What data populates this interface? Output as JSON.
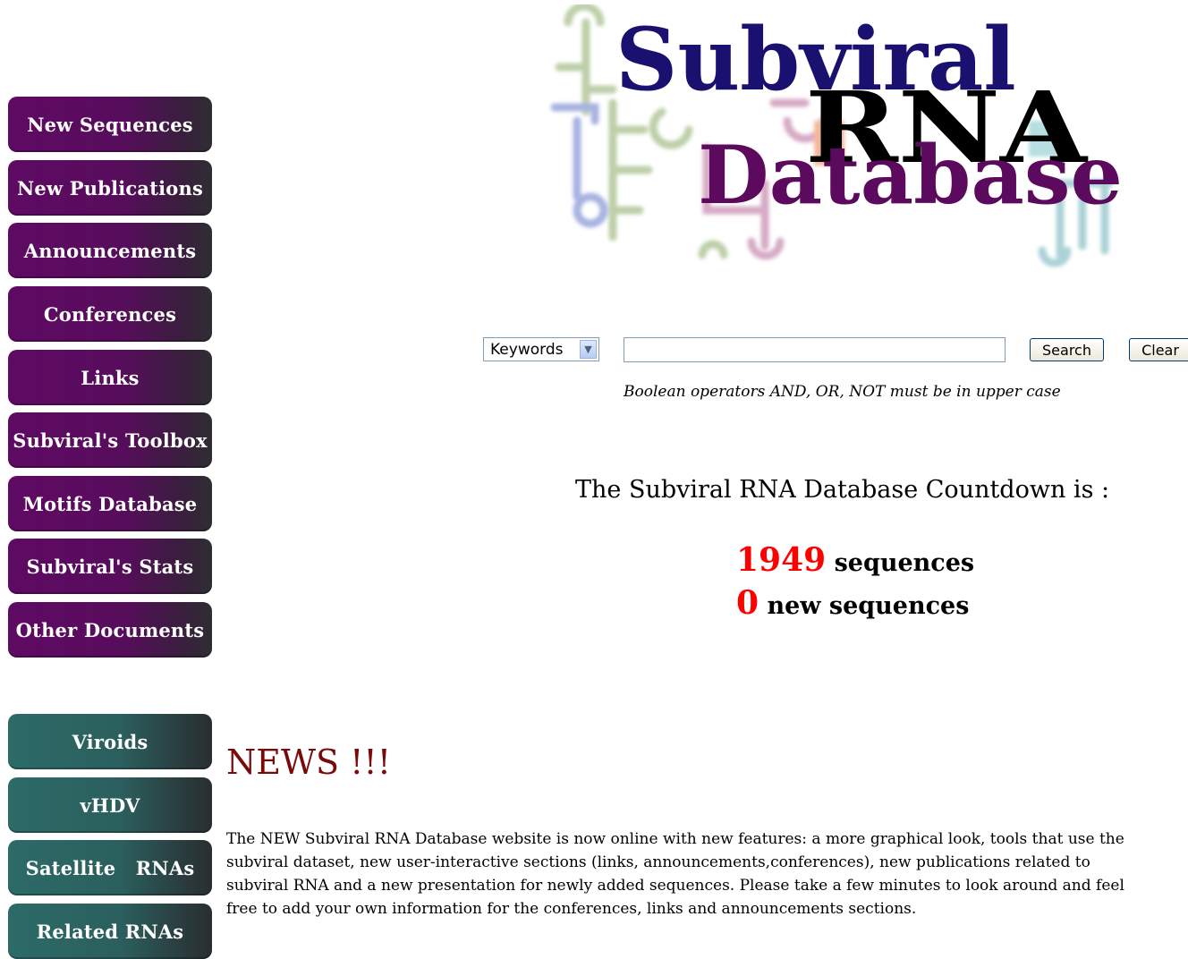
{
  "nav_primary": [
    {
      "label": "New Sequences"
    },
    {
      "label": "New Publications"
    },
    {
      "label": "Announcements"
    },
    {
      "label": "Conferences"
    },
    {
      "label": "Links"
    },
    {
      "label": "Subviral's Toolbox"
    },
    {
      "label": "Motifs Database"
    },
    {
      "label": "Subviral's Stats"
    },
    {
      "label": "Other Documents"
    }
  ],
  "nav_secondary": [
    {
      "label": "Viroids"
    },
    {
      "label": "vHDV"
    },
    {
      "label": "Satellite   RNAs"
    },
    {
      "label": "Related RNAs"
    }
  ],
  "logo": {
    "line1": "Subviral",
    "line2": "RNA",
    "line3": "Database"
  },
  "search": {
    "field_selected": "Keywords",
    "query": "",
    "search_label": "Search",
    "clear_label": "Clear",
    "hint": "Boolean operators AND, OR, NOT must be in upper case"
  },
  "countdown": {
    "title": "The Subviral RNA Database Countdown is :",
    "sequences_count": "1949",
    "sequences_label": "sequences",
    "new_count": "0",
    "new_label": "new sequences"
  },
  "news": {
    "heading": "NEWS !!!",
    "body": "The NEW Subviral RNA Database website is now online with new features: a more graphical look, tools that use the subviral dataset, new user-interactive sections (links, announcements,conferences), new publications related to subviral RNA and a new presentation for newly added sequences. Please take a few minutes to look around and feel free to add your own information for the conferences, links and announcements sections."
  },
  "colors": {
    "nav_purple": "#5e0a63",
    "nav_teal": "#2c6b68",
    "count_red": "#ff0000",
    "news_red": "#7a0a0a",
    "logo_navy": "#1a1070",
    "logo_purple": "#5c0a5e"
  }
}
